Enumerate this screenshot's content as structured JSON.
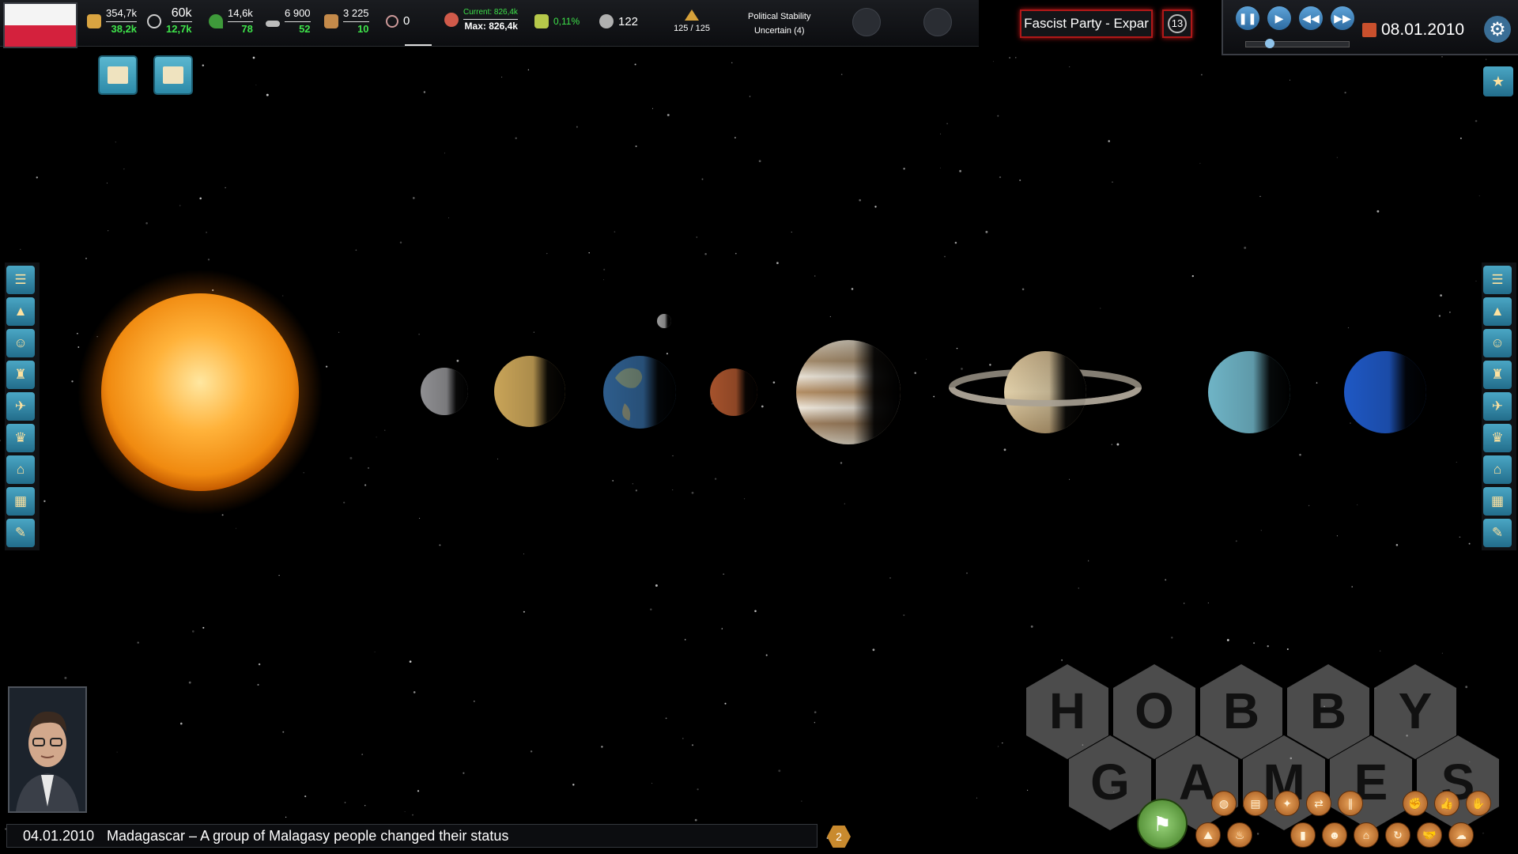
{
  "header": {
    "flag_colors": [
      "#f4f4f4",
      "#d4213d"
    ],
    "stats": [
      {
        "name": "treasury",
        "icon": "money-bag-icon",
        "top": "354,7k",
        "bottom": "38,2k"
      },
      {
        "name": "income",
        "icon": "cycle-icon",
        "top": "60k",
        "bottom": "12,7k"
      },
      {
        "name": "food",
        "icon": "plant-icon",
        "top": "14,6k",
        "bottom": "78"
      },
      {
        "name": "oil",
        "icon": "oil-icon",
        "top": "6 900",
        "bottom": "52"
      },
      {
        "name": "goods",
        "icon": "box-icon",
        "top": "3 225",
        "bottom": "10"
      }
    ],
    "research_value": "0",
    "population": {
      "current": "Current: 826,4k",
      "max": "Max: 826,4k"
    },
    "growth": "0,11%",
    "approval": "122",
    "military_units": "125 / 125",
    "political_stability": {
      "title": "Political Stability",
      "value": "Uncertain (4)"
    },
    "party": "Fascist Party - Expar",
    "party_count": "13"
  },
  "time": {
    "date": "08.01.2010",
    "speed_level": 0.2,
    "buttons": [
      "pause-icon",
      "play-icon",
      "rewind-icon",
      "fast-forward-icon"
    ]
  },
  "left_menu": [
    "diplomacy-icon",
    "economy-icon",
    "population-icon",
    "trade-icon",
    "military-icon",
    "laws-icon",
    "construction-icon",
    "budget-icon",
    "documents-icon"
  ],
  "right_menu": [
    "handshake-icon",
    "alliance-icon",
    "award-icon",
    "more-icon",
    "spy-icon",
    "globe-icon",
    "officer-icon",
    "treasury-icon",
    "nuclear-icon"
  ],
  "news": {
    "date": "04.01.2010",
    "text": "Madagascar – A group of Malagasy people changed their status",
    "count": "2"
  },
  "watermark": {
    "row1": [
      "H",
      "O",
      "B",
      "B",
      "Y"
    ],
    "row2": [
      "G",
      "A",
      "M",
      "E",
      "S"
    ]
  },
  "colors": {
    "accent": "#3ee24a",
    "party_border": "#b01818",
    "button_blue": "#3a86b0",
    "action_orange": "#c76f27"
  }
}
